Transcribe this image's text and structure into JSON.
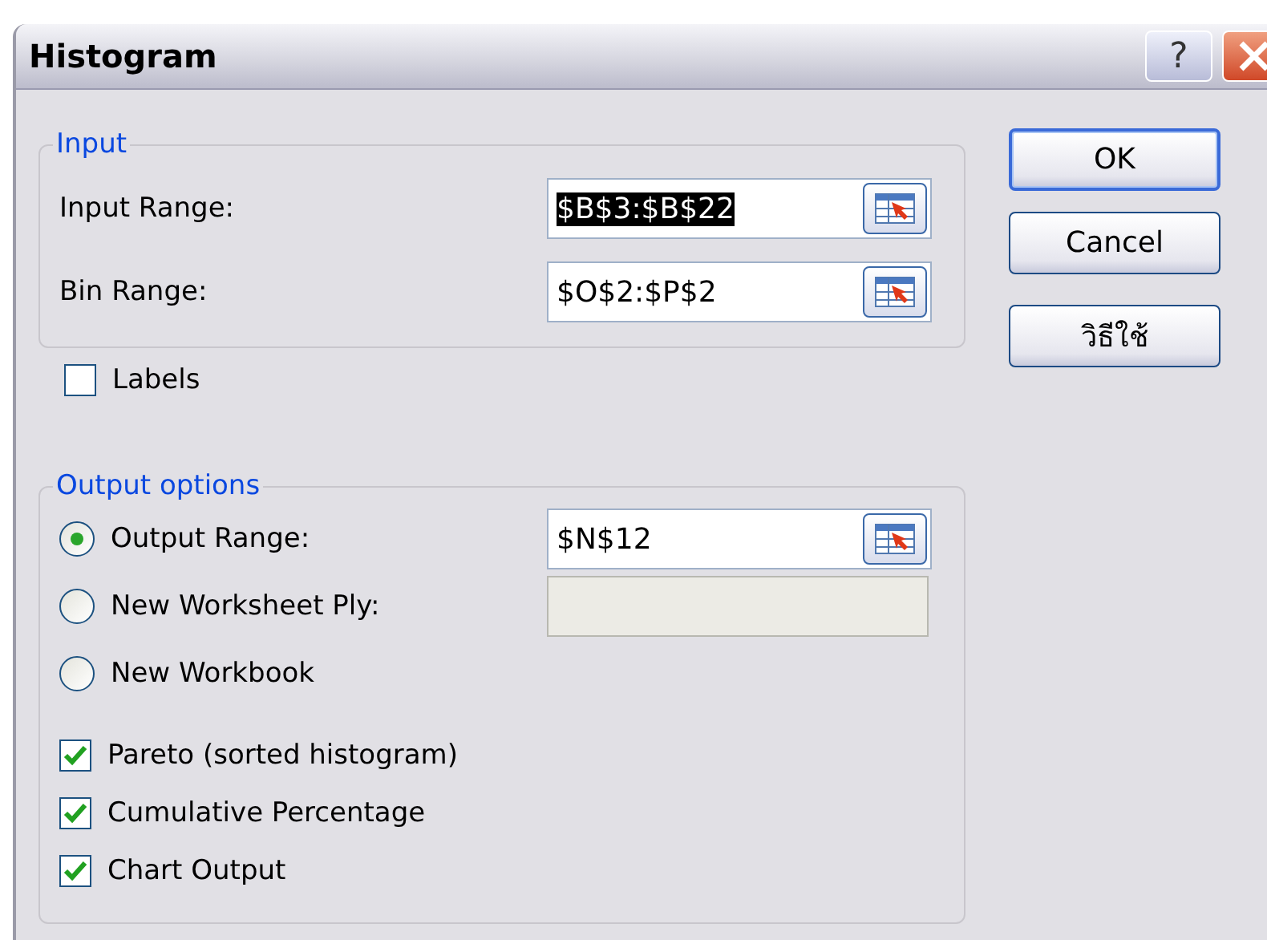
{
  "window": {
    "title": "Histogram",
    "help_button": "?"
  },
  "input_group": {
    "title": "Input",
    "fields": [
      {
        "label": "Input Range:",
        "value": "$B$3:$B$22",
        "text_selected": true
      },
      {
        "label": "Bin Range:",
        "value": "$O$2:$P$2",
        "text_selected": false
      }
    ]
  },
  "labels_checkbox": {
    "label": "Labels",
    "checked": false
  },
  "output_group": {
    "title": "Output options",
    "options": [
      {
        "label": "Output Range:",
        "selected": true,
        "field": {
          "value": "$N$12",
          "disabled": false
        }
      },
      {
        "label": "New Worksheet Ply:",
        "selected": false,
        "field": {
          "disabled": true
        }
      },
      {
        "label": "New Workbook",
        "selected": false
      }
    ],
    "checkboxes": [
      {
        "label": "Pareto (sorted histogram)",
        "checked": true
      },
      {
        "label": "Cumulative Percentage",
        "checked": true
      },
      {
        "label": "Chart Output",
        "checked": true
      }
    ]
  },
  "buttons": [
    {
      "label": "OK",
      "default": true
    },
    {
      "label": "Cancel",
      "default": false
    },
    {
      "label": "วิธีใช้",
      "default": false
    }
  ]
}
